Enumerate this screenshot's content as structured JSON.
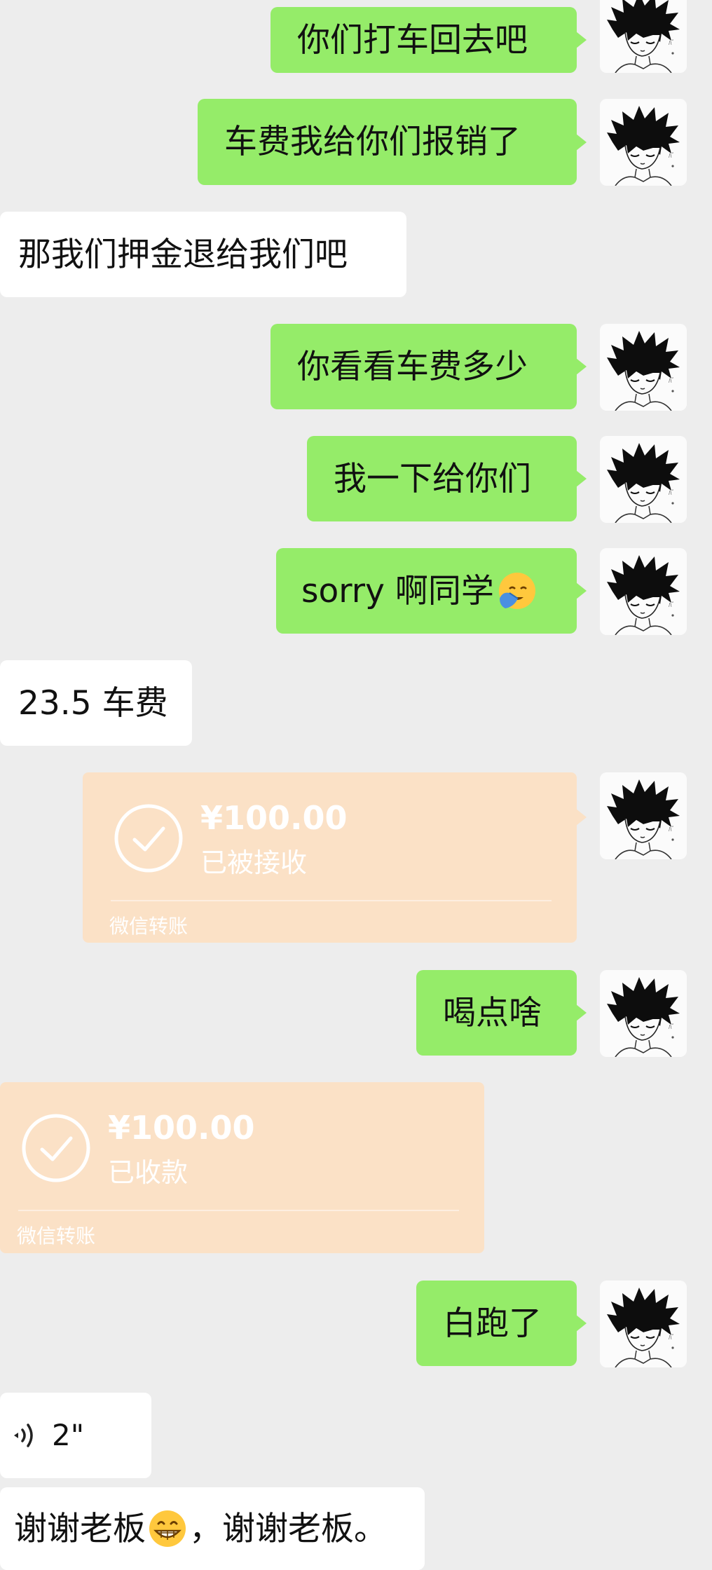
{
  "chat": {
    "messages": [
      {
        "side": "out",
        "type": "text",
        "text": "你们打车回去吧"
      },
      {
        "side": "out",
        "type": "text",
        "text": "车费我给你们报销了"
      },
      {
        "side": "in",
        "type": "text",
        "text": "那我们押金退给我们吧"
      },
      {
        "side": "out",
        "type": "text",
        "text": "你看看车费多少"
      },
      {
        "side": "out",
        "type": "text",
        "text": "我一下给你们"
      },
      {
        "side": "out",
        "type": "text",
        "text": "sorry 啊同学",
        "emoji": "facepalm-emoji"
      },
      {
        "side": "in",
        "type": "text",
        "text": "23.5 车费"
      },
      {
        "side": "out",
        "type": "transfer",
        "amount": "¥100.00",
        "status": "已被接收",
        "label": "微信转账"
      },
      {
        "side": "out",
        "type": "text",
        "text": "喝点啥"
      },
      {
        "side": "in",
        "type": "transfer",
        "amount": "¥100.00",
        "status": "已收款",
        "label": "微信转账"
      },
      {
        "side": "out",
        "type": "text",
        "text": "白跑了"
      },
      {
        "side": "in",
        "type": "voice",
        "duration": "2\""
      },
      {
        "side": "in",
        "type": "text",
        "text_a": "谢谢老板",
        "emoji": "grin-emoji",
        "text_b": "，谢谢老板。"
      }
    ]
  },
  "colors": {
    "background": "#ededed",
    "outgoing_bubble": "#95ec69",
    "incoming_bubble": "#ffffff",
    "transfer_card": "#fbe1c6"
  },
  "icons": {
    "avatar": "anime-boy-avatar-icon",
    "transfer_check": "check-circle-icon",
    "voice": "voice-wave-icon"
  }
}
